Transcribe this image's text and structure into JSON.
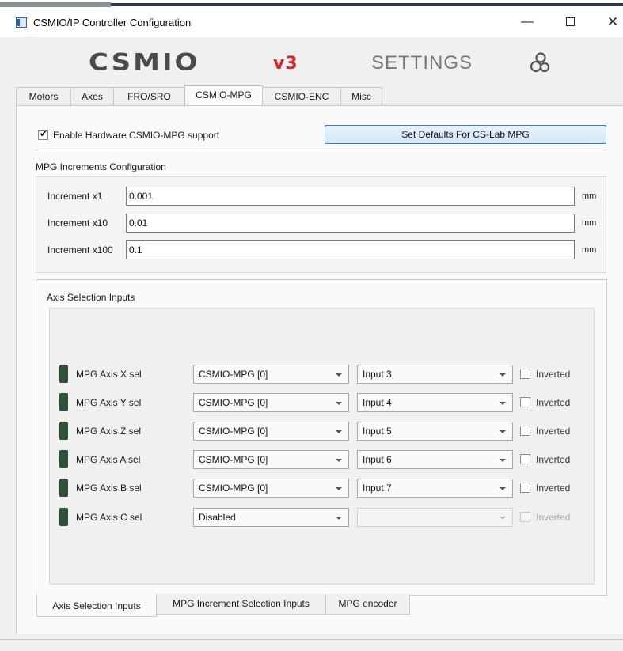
{
  "window": {
    "title": "CSMIO/IP Controller Configuration",
    "minimize": "—",
    "close": "✕"
  },
  "header": {
    "logo_text": "CSMIO",
    "logo_suffix": "v3",
    "settings_label": "SETTINGS",
    "gear_icon": "gear-cluster-icon"
  },
  "tabs": [
    {
      "label": "Motors",
      "active": false
    },
    {
      "label": "Axes",
      "active": false
    },
    {
      "label": "FRO/SRO",
      "active": false
    },
    {
      "label": "CSMIO-MPG",
      "active": true
    },
    {
      "label": "CSMIO-ENC",
      "active": false
    },
    {
      "label": "Misc",
      "active": false
    }
  ],
  "mpg": {
    "enable_label": "Enable Hardware CSMIO-MPG support",
    "enable_checked": true,
    "defaults_button": "Set Defaults For CS-Lab MPG",
    "increments_section": "MPG Increments Configuration",
    "increments": [
      {
        "label": "Increment x1",
        "value": "0.001",
        "unit": "mm"
      },
      {
        "label": "Increment x10",
        "value": "0.01",
        "unit": "mm"
      },
      {
        "label": "Increment x100",
        "value": "0.1",
        "unit": "mm"
      }
    ],
    "axis_section": "Axis Selection Inputs",
    "axes": [
      {
        "label": "MPG Axis X sel",
        "source": "CSMIO-MPG [0]",
        "input": "Input 3",
        "inverted_label": "Inverted",
        "inverted": false,
        "enabled": true
      },
      {
        "label": "MPG Axis Y sel",
        "source": "CSMIO-MPG [0]",
        "input": "Input 4",
        "inverted_label": "Inverted",
        "inverted": false,
        "enabled": true
      },
      {
        "label": "MPG Axis Z sel",
        "source": "CSMIO-MPG [0]",
        "input": "Input 5",
        "inverted_label": "Inverted",
        "inverted": false,
        "enabled": true
      },
      {
        "label": "MPG Axis A sel",
        "source": "CSMIO-MPG [0]",
        "input": "Input 6",
        "inverted_label": "Inverted",
        "inverted": false,
        "enabled": true
      },
      {
        "label": "MPG Axis B sel",
        "source": "CSMIO-MPG [0]",
        "input": "Input 7",
        "inverted_label": "Inverted",
        "inverted": false,
        "enabled": true
      },
      {
        "label": "MPG Axis C sel",
        "source": "Disabled",
        "input": "",
        "inverted_label": "Inverted",
        "inverted": false,
        "enabled": false
      }
    ],
    "bottom_tabs": [
      {
        "label": "Axis Selection Inputs",
        "active": true
      },
      {
        "label": "MPG Increment Selection Inputs",
        "active": false
      },
      {
        "label": "MPG encoder",
        "active": false
      }
    ]
  },
  "colors": {
    "accent": "#3d7bc9",
    "led_off": "#2f5236",
    "logo_red": "#d22a2a"
  }
}
